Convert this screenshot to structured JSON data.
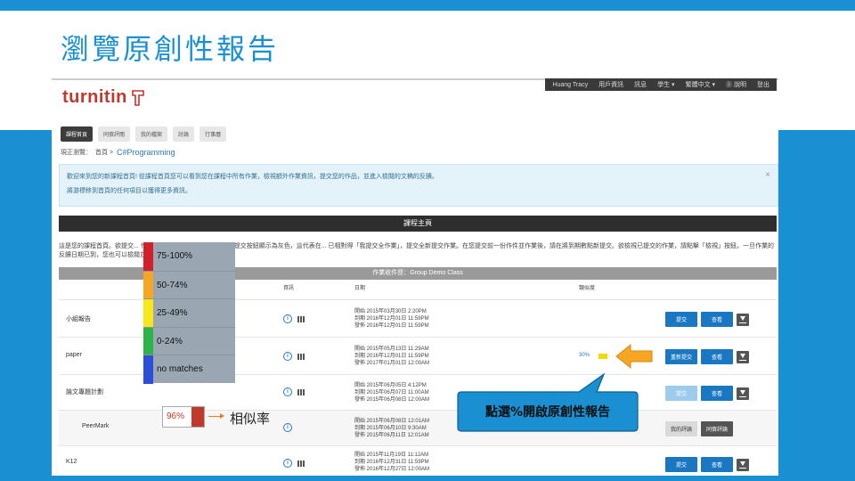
{
  "slide": {
    "title": "瀏覽原創性報告"
  },
  "user_nav": [
    "Huang Tracy",
    "用戶資訊",
    "訊息",
    "學生 ▾",
    "繁體中文 ▾",
    "⓪ 說明",
    "登出"
  ],
  "brand": {
    "name": "turnitin"
  },
  "tabs": [
    {
      "label": "課程首頁",
      "active": true
    },
    {
      "label": "同儕評閱",
      "active": false
    },
    {
      "label": "我的檔案",
      "active": false
    },
    {
      "label": "討論",
      "active": false
    },
    {
      "label": "行事曆",
      "active": false
    }
  ],
  "breadcrumb": {
    "prefix": "現正瀏覽：",
    "home": "首頁 >",
    "course": "C#Programming"
  },
  "info_box": {
    "line1": "歡迎來到您的新課程首頁! 從課程首頁您可以看到您在課程中所有作業，檢視額外作業資訊，提交您的作品，並進入檢閱的文稿的反饋。",
    "line2": "將游標移到首頁的任何項目以獲得更多資訊。",
    "close": "×"
  },
  "home_bar": "課程主頁",
  "paragraph": "這是您的課程首頁。欲提交... 作業時，請點擊「提交」按鈕。若提交按鈕顯示為灰色，這代表在... 已相對得「我提交全作業」，提交全新提交作業。在您提交前一份作件並作業後，請在將到期數點新提交。欲檢視已提交的作業，請點擊「檢視」按鈕。一旦作業的反饋日期已到，您也可以檢閱並瀏覽提點反饋。",
  "panel": {
    "title": "作業收件匣：Group Demo Class",
    "columns": {
      "info": "資訊",
      "dates": "日期",
      "similarity": "類似度"
    },
    "rows": [
      {
        "name": "小組報告",
        "dates": [
          "開始 2015年03月30日 2:20PM",
          "到期 2016年12月01日 11:59PM",
          "發佈 2016年12月01日 11:59PM"
        ],
        "similarity": "",
        "actions": [
          "提交",
          "查看"
        ]
      },
      {
        "name": "paper",
        "dates": [
          "開始 2015年05月13日 11:29AM",
          "到期 2016年12月01日 11:59PM",
          "發佈 2017年01月01日 12:00AM"
        ],
        "similarity": "30%",
        "actions": [
          "重新提交",
          "查看"
        ]
      },
      {
        "name": "論文專題計劃",
        "dates": [
          "開始 2015年06月05日 4:12PM",
          "到期 2015年06月07日 11:00AM",
          "發佈 2015年06月08日 12:00AM"
        ],
        "similarity": "",
        "actions": [
          "提交",
          "查看"
        ]
      },
      {
        "name": "PeerMark",
        "dates": [
          "開始 2015年06月08日 12:01AM",
          "到期 2015年06月10日 9:30AM",
          "發佈 2015年06月11日 12:01AM"
        ],
        "similarity": "",
        "actions": [
          "我的評論",
          "同儕評論"
        ]
      },
      {
        "name": "K12",
        "dates": [
          "開始 2015年11月19日 11:12AM",
          "到期 2016年12月31日 11:59PM",
          "發佈 2016年12月27日 12:00AM"
        ],
        "similarity": "",
        "actions": [
          "提交",
          "查看"
        ]
      }
    ]
  },
  "legend": [
    {
      "label": "75-100%",
      "color": "#d21f2a"
    },
    {
      "label": "50-74%",
      "color": "#f5a623"
    },
    {
      "label": "25-49%",
      "color": "#f8e71c"
    },
    {
      "label": "0-24%",
      "color": "#2db34a"
    },
    {
      "label": "no matches",
      "color": "#2b4fd6"
    }
  ],
  "sample_badge": {
    "value": "96%"
  },
  "similarity_label": "相似率",
  "callout": "點選%開啟原創性報告",
  "colors": {
    "accent": "#1a8fd1",
    "button": "#1a78c2",
    "pointer": "#f5a623"
  }
}
